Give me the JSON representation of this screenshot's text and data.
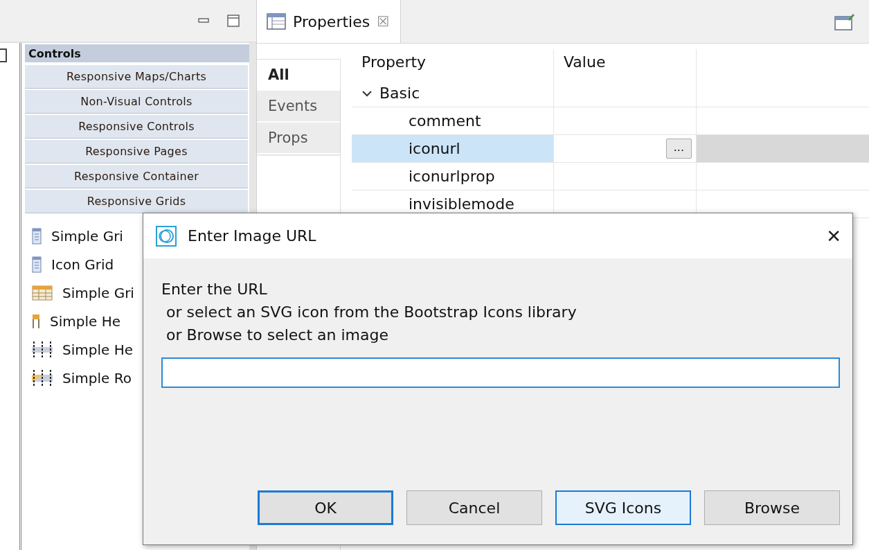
{
  "palette": {
    "title": "Controls",
    "categories": [
      "Responsive Maps/Charts",
      "Non-Visual Controls",
      "Responsive Controls",
      "Responsive Pages",
      "Responsive Container",
      "Responsive Grids"
    ],
    "items": [
      {
        "label": "Simple Gri",
        "kind": "form"
      },
      {
        "label": "Icon Grid",
        "kind": "form"
      },
      {
        "label": "Simple Gri",
        "kind": "table"
      },
      {
        "label": "Simple He",
        "kind": "header"
      },
      {
        "label": "Simple He",
        "kind": "header-rows"
      },
      {
        "label": "Simple Ro",
        "kind": "row"
      }
    ]
  },
  "properties_view": {
    "tab": {
      "label": "Properties",
      "close": "☒"
    },
    "side_tabs": [
      {
        "label": "All",
        "selected": true
      },
      {
        "label": "Events",
        "selected": false
      },
      {
        "label": "Props",
        "selected": false
      }
    ],
    "table": {
      "columns": [
        "Property",
        "Value"
      ],
      "rows": [
        {
          "name": "Basic",
          "kind": "group",
          "expanded": true
        },
        {
          "name": "comment",
          "kind": "property",
          "selected": false
        },
        {
          "name": "iconurl",
          "kind": "property",
          "selected": true,
          "value_button": "..."
        },
        {
          "name": "iconurlprop",
          "kind": "property",
          "selected": false
        },
        {
          "name": "invisiblemode",
          "kind": "property",
          "selected": false
        }
      ]
    }
  },
  "dialog": {
    "title": "Enter Image URL",
    "close": "✕",
    "message_lines": [
      "Enter the URL",
      " or select an SVG icon from the Bootstrap Icons library",
      " or Browse to select an image"
    ],
    "buttons": [
      {
        "label": "OK",
        "focused": true,
        "hovered": false
      },
      {
        "label": "Cancel",
        "focused": false,
        "hovered": false
      },
      {
        "label": "SVG Icons",
        "focused": false,
        "hovered": true
      },
      {
        "label": "Browse",
        "focused": false,
        "hovered": false
      }
    ]
  }
}
